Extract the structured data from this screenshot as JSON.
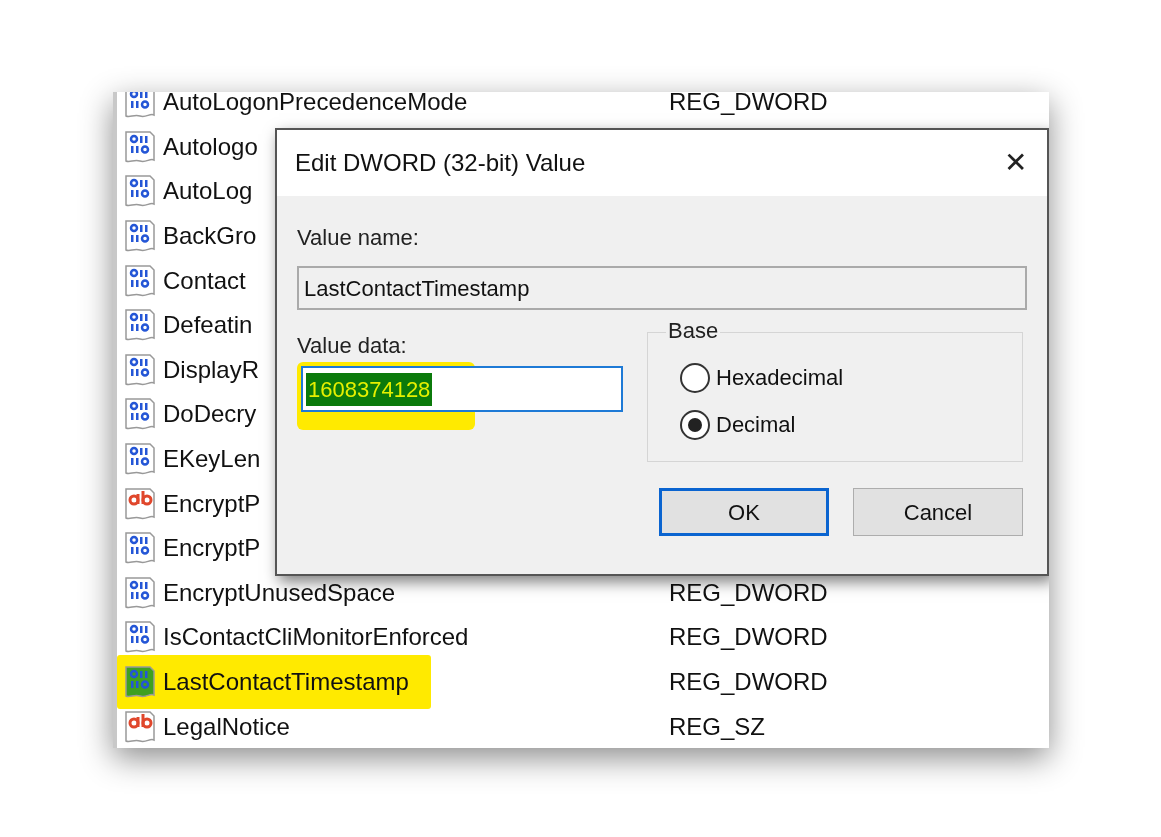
{
  "registry_values": [
    {
      "kind": "dword",
      "name": "AutoLogonPrecedenceMode",
      "type": "REG_DWORD",
      "highlighted": false
    },
    {
      "kind": "dword",
      "name": "Autologo",
      "highlighted": false
    },
    {
      "kind": "dword",
      "name": "AutoLog",
      "highlighted": false
    },
    {
      "kind": "dword",
      "name": "BackGro",
      "highlighted": false
    },
    {
      "kind": "dword",
      "name": "Contact",
      "highlighted": false
    },
    {
      "kind": "dword",
      "name": "Defeatin",
      "highlighted": false
    },
    {
      "kind": "dword",
      "name": "DisplayR",
      "highlighted": false
    },
    {
      "kind": "dword",
      "name": "DoDecry",
      "highlighted": false
    },
    {
      "kind": "dword",
      "name": "EKeyLen",
      "highlighted": false
    },
    {
      "kind": "string",
      "name": "EncryptP",
      "highlighted": false
    },
    {
      "kind": "dword",
      "name": "EncryptP",
      "highlighted": false
    },
    {
      "kind": "dword",
      "name": "EncryptUnusedSpace",
      "type": "REG_DWORD",
      "highlighted": false
    },
    {
      "kind": "dword",
      "name": "IsContactCliMonitorEnforced",
      "type": "REG_DWORD",
      "highlighted": false
    },
    {
      "kind": "dword",
      "name": "LastContactTimestamp",
      "type": "REG_DWORD",
      "highlighted": true
    },
    {
      "kind": "string",
      "name": "LegalNotice",
      "type": "REG_SZ",
      "highlighted": false
    }
  ],
  "dialog": {
    "title": "Edit DWORD (32-bit) Value",
    "close": "✕",
    "value_name_label": "Value name:",
    "value_name": "LastContactTimestamp",
    "value_data_label": "Value data:",
    "value_data": "1608374128",
    "value_data_highlighted": true,
    "base": {
      "label": "Base",
      "options": [
        {
          "label": "Hexadecimal",
          "selected": false
        },
        {
          "label": "Decimal",
          "selected": true
        }
      ]
    },
    "buttons": [
      {
        "label": "OK",
        "default": true
      },
      {
        "label": "Cancel",
        "default": false
      }
    ]
  }
}
